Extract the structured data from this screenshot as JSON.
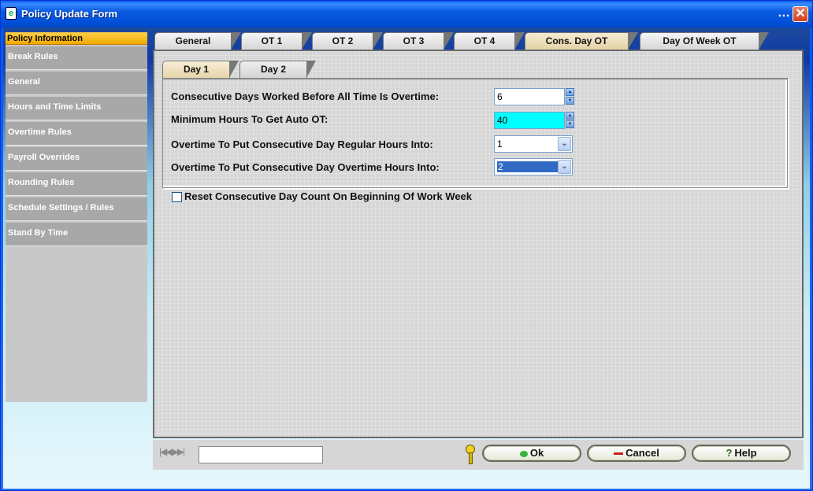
{
  "window": {
    "title": "Policy Update Form",
    "more": "…",
    "close": "✕",
    "app_icon": "e"
  },
  "sidebar": {
    "header": "Policy Information",
    "items": [
      {
        "label": "Break Rules"
      },
      {
        "label": "General"
      },
      {
        "label": "Hours and Time Limits"
      },
      {
        "label": "Overtime Rules"
      },
      {
        "label": "Payroll Overrides"
      },
      {
        "label": "Rounding Rules"
      },
      {
        "label": "Schedule Settings / Rules"
      },
      {
        "label": "Stand By Time"
      }
    ]
  },
  "tabs": [
    {
      "label": "General"
    },
    {
      "label": "OT 1"
    },
    {
      "label": "OT 2"
    },
    {
      "label": "OT 3"
    },
    {
      "label": "OT 4"
    },
    {
      "label": "Cons. Day OT",
      "active": true
    },
    {
      "label": "Day Of Week OT"
    }
  ],
  "subtabs": [
    {
      "label": "Day 1",
      "active": true
    },
    {
      "label": "Day 2"
    }
  ],
  "form": {
    "consecutive_days_label": "Consecutive Days Worked Before All Time Is Overtime:",
    "consecutive_days_value": "6",
    "min_hours_label": "Minimum Hours To Get Auto OT:",
    "min_hours_value": "40",
    "regular_hours_label": "Overtime To Put Consecutive Day Regular Hours Into:",
    "regular_hours_value": "1",
    "overtime_hours_label": "Overtime To Put Consecutive Day Overtime Hours Into:",
    "overtime_hours_value": "2",
    "reset_label": "Reset Consecutive Day Count On Beginning Of Work Week",
    "reset_checked": false
  },
  "bottom": {
    "nav_arrows": "|◀◀▶▶|",
    "ok_label": "Ok",
    "cancel_label": "Cancel",
    "help_label": "Help",
    "help_icon": "?"
  }
}
